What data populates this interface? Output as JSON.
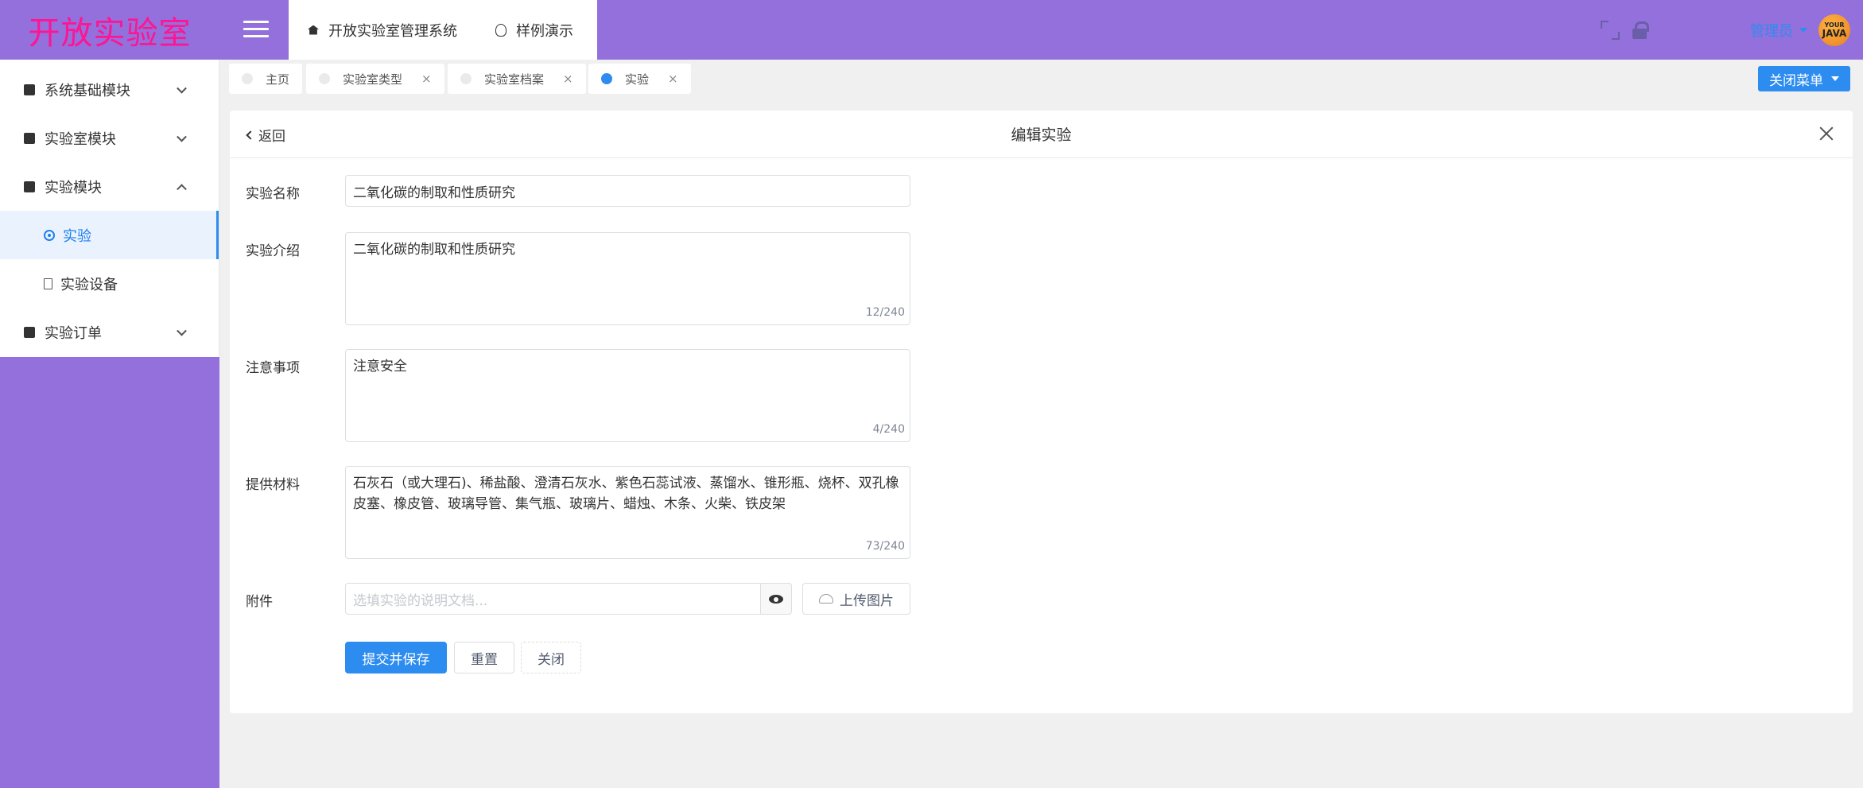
{
  "brand": {
    "title": "开放实验室"
  },
  "sidebar": {
    "items": [
      {
        "label": "系统基础模块",
        "icon": "chart-icon"
      },
      {
        "label": "实验室模块",
        "icon": "book-icon"
      },
      {
        "label": "实验模块",
        "icon": "clipboard-icon"
      },
      {
        "label": "实验",
        "icon": "gear-icon"
      },
      {
        "label": "实验设备",
        "icon": "document-icon"
      },
      {
        "label": "实验订单",
        "icon": "checklist-icon"
      }
    ]
  },
  "header": {
    "tabs": [
      {
        "label": "开放实验室管理系统",
        "icon": "home-icon"
      },
      {
        "label": "样例演示",
        "icon": "bulb-icon"
      }
    ],
    "user": {
      "name": "管理员",
      "avatar_text_top": "YOUR",
      "avatar_text_main": "JAVA"
    }
  },
  "tagbar": {
    "tags": [
      {
        "label": "主页"
      },
      {
        "label": "实验室类型",
        "close": "×"
      },
      {
        "label": "实验室档案",
        "close": "×"
      },
      {
        "label": "实验",
        "close": "×"
      }
    ],
    "close_menu_label": "关闭菜单"
  },
  "card": {
    "back_label": "返回",
    "title": "编辑实验",
    "fields": {
      "name": {
        "label": "实验名称",
        "value": "二氧化碳的制取和性质研究"
      },
      "intro": {
        "label": "实验介绍",
        "value": "二氧化碳的制取和性质研究",
        "counter": "12/240"
      },
      "notes": {
        "label": "注意事项",
        "value": "注意安全",
        "counter": "4/240"
      },
      "materials": {
        "label": "提供材料",
        "value": "石灰石（或大理石)、稀盐酸、澄清石灰水、紫色石蕊试液、蒸馏水、锥形瓶、烧杯、双孔橡皮塞、橡皮管、玻璃导管、集气瓶、玻璃片、蜡烛、木条、火柴、铁皮架",
        "counter": "73/240"
      },
      "attachment": {
        "label": "附件",
        "placeholder": "选填实验的说明文档...",
        "upload_label": "上传图片"
      }
    },
    "buttons": {
      "submit": "提交并保存",
      "reset": "重置",
      "close": "关闭"
    }
  },
  "colors": {
    "sidebar_bg": "#9370db",
    "brand_text": "#ff1493",
    "accent": "#2d8cf0",
    "page_bg": "#f0f0f0"
  }
}
